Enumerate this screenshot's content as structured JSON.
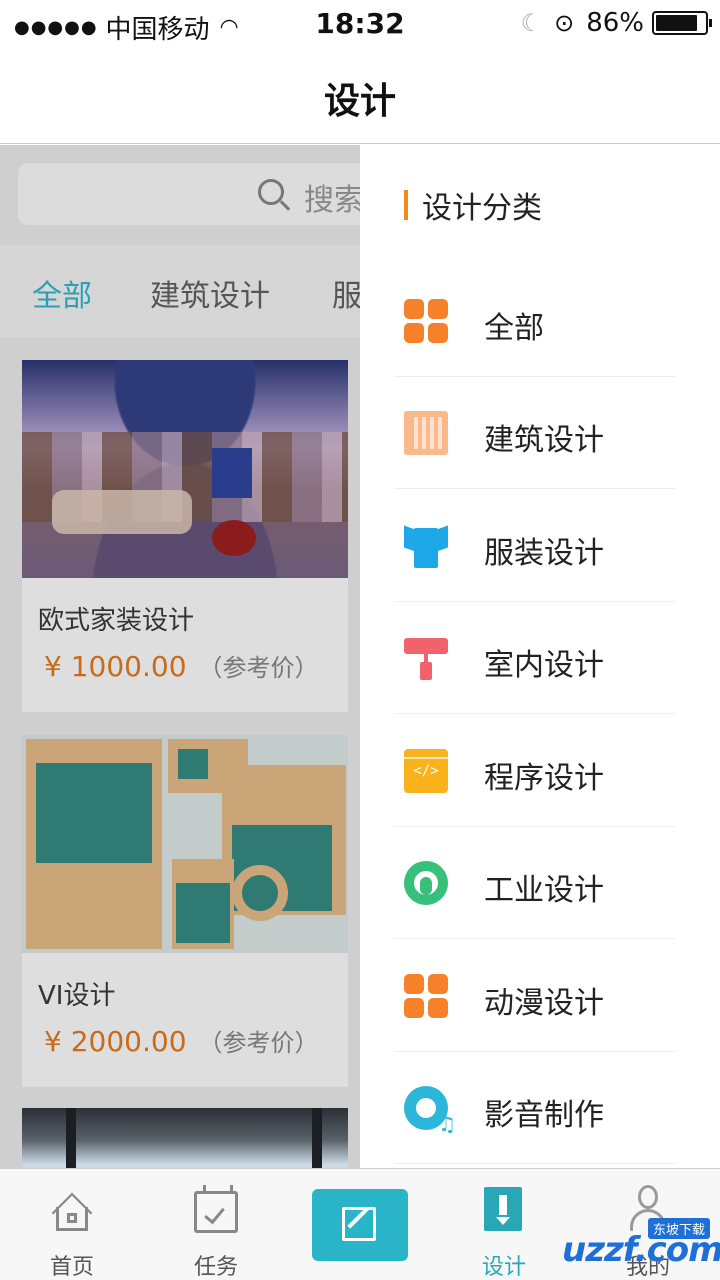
{
  "status_bar": {
    "signal_dots": "●●●●●",
    "carrier": "中国移动",
    "time": "18:32",
    "battery_percent": "86%",
    "battery_level": 0.86
  },
  "nav": {
    "title": "设计"
  },
  "search": {
    "placeholder": "搜索"
  },
  "category_tabs": [
    "全部",
    "建筑设计",
    "服"
  ],
  "products": [
    {
      "name": "欧式家装设计",
      "price": "¥ 1000.00",
      "price_note": "（参考价）"
    },
    {
      "name": "VI设计",
      "price": "¥ 2000.00",
      "price_note": "（参考价）"
    }
  ],
  "drawer": {
    "heading": "设计分类",
    "accent_color": "#f08c1e",
    "items": [
      {
        "label": "全部",
        "icon": "grid-icon"
      },
      {
        "label": "建筑设计",
        "icon": "building-icon"
      },
      {
        "label": "服装设计",
        "icon": "shirt-icon"
      },
      {
        "label": "室内设计",
        "icon": "paint-roller-icon"
      },
      {
        "label": "程序设计",
        "icon": "code-window-icon"
      },
      {
        "label": "工业设计",
        "icon": "gear-icon"
      },
      {
        "label": "动漫设计",
        "icon": "grid-icon"
      },
      {
        "label": "影音制作",
        "icon": "disc-music-icon"
      }
    ]
  },
  "tabbar": {
    "items": [
      {
        "label": "首页",
        "icon": "home-icon"
      },
      {
        "label": "任务",
        "icon": "task-icon"
      },
      {
        "label": "",
        "icon": "edit-icon"
      },
      {
        "label": "设计",
        "icon": "design-icon",
        "active": true
      },
      {
        "label": "我的",
        "icon": "user-icon"
      }
    ],
    "active_color": "#2aa7b7"
  },
  "watermark": {
    "brand": "uzzf.com",
    "tag": "东坡下载"
  }
}
